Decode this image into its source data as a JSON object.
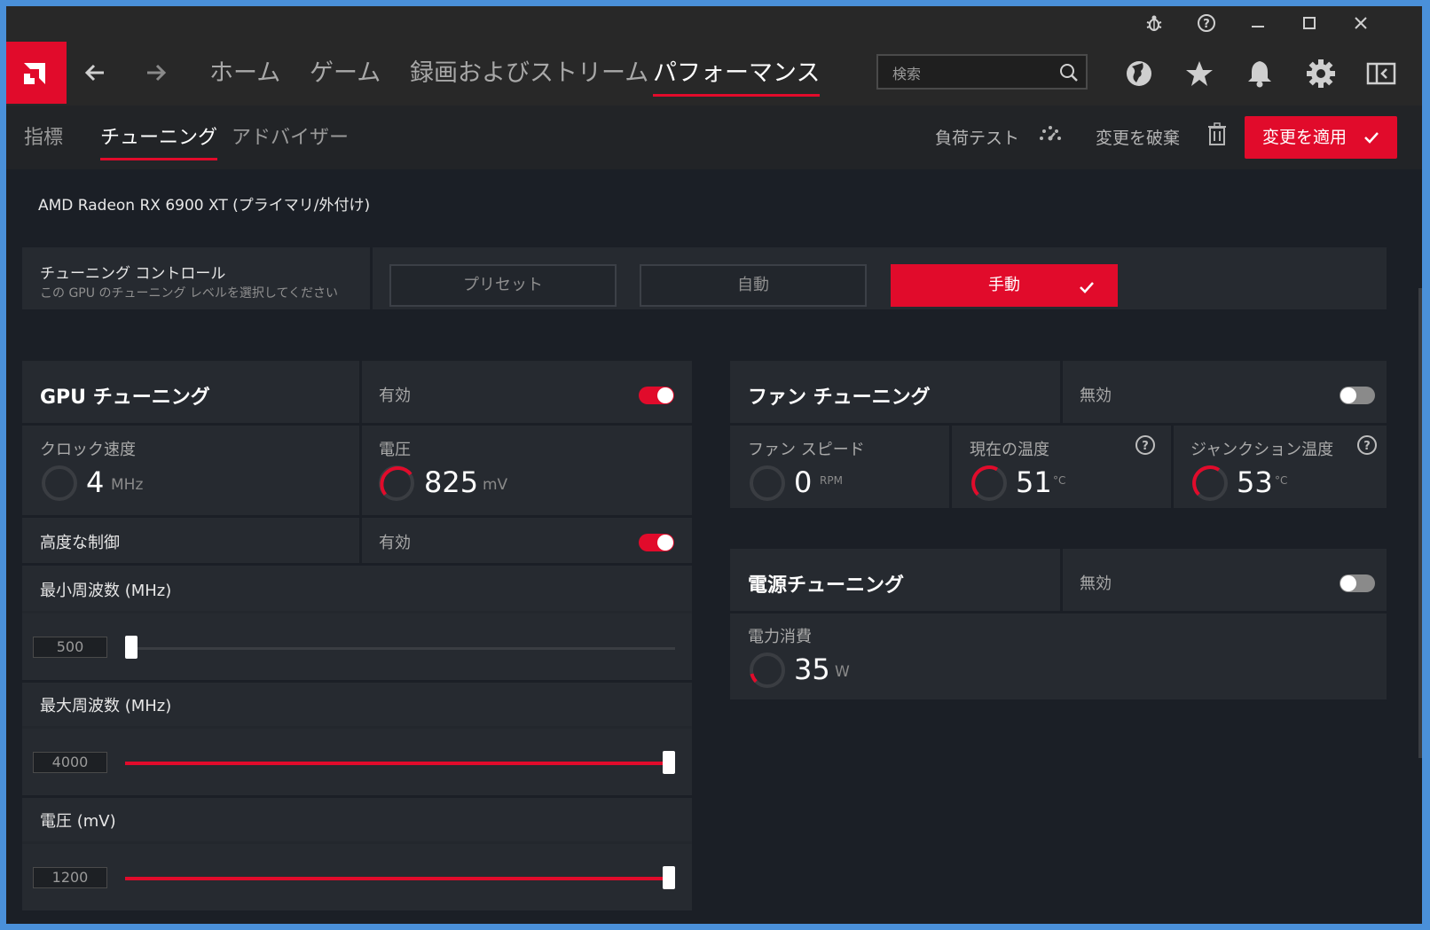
{
  "titlebar": {
    "icons": [
      "bug-icon",
      "help-icon",
      "minimize-icon",
      "maximize-icon",
      "close-icon"
    ]
  },
  "nav": {
    "tabs": [
      {
        "label": "ホーム"
      },
      {
        "label": "ゲーム"
      },
      {
        "label": "録画およびストリーム"
      },
      {
        "label": "パフォーマンス",
        "active": true
      }
    ],
    "search_placeholder": "検索",
    "icons": [
      "globe-icon",
      "star-icon",
      "bell-icon",
      "gear-icon",
      "sidebar-icon"
    ]
  },
  "subnav": {
    "tabs": [
      {
        "label": "指標"
      },
      {
        "label": "チューニング",
        "active": true
      },
      {
        "label": "アドバイザー"
      }
    ],
    "stress_test": "負荷テスト",
    "discard": "変更を破棄",
    "apply": "変更を適用"
  },
  "device": "AMD Radeon RX 6900 XT (プライマリ/外付け)",
  "tuning_control": {
    "title": "チューニング コントロール",
    "subtitle": "この GPU のチューニング レベルを選択してください",
    "options": [
      "プリセット",
      "自動",
      "手動"
    ],
    "selected": "手動"
  },
  "gpu_tuning": {
    "title": "GPU チューニング",
    "status": "有効",
    "enabled": true,
    "clock": {
      "label": "クロック速度",
      "value": "4",
      "unit": "MHz"
    },
    "voltage": {
      "label": "電圧",
      "value": "825",
      "unit": "mV"
    },
    "advanced": {
      "label": "高度な制御",
      "status": "有効",
      "enabled": true
    },
    "sliders": [
      {
        "label": "最小周波数 (MHz)",
        "value": "500",
        "fraction": 0.0
      },
      {
        "label": "最大周波数 (MHz)",
        "value": "4000",
        "fraction": 1.0
      },
      {
        "label": "電圧 (mV)",
        "value": "1200",
        "fraction": 1.0
      }
    ]
  },
  "fan_tuning": {
    "title": "ファン チューニング",
    "status": "無効",
    "enabled": false,
    "fan_speed": {
      "label": "ファン スピード",
      "value": "0",
      "unit": "RPM"
    },
    "current_temp": {
      "label": "現在の温度",
      "value": "51",
      "unit": "°C"
    },
    "junction_temp": {
      "label": "ジャンクション温度",
      "value": "53",
      "unit": "°C"
    }
  },
  "power_tuning": {
    "title": "電源チューニング",
    "status": "無効",
    "enabled": false,
    "power": {
      "label": "電力消費",
      "value": "35",
      "unit": "W"
    }
  },
  "colors": {
    "accent": "#e10b2b",
    "bg": "#1b1f26",
    "card": "#262a30",
    "titlebar": "#282828"
  }
}
